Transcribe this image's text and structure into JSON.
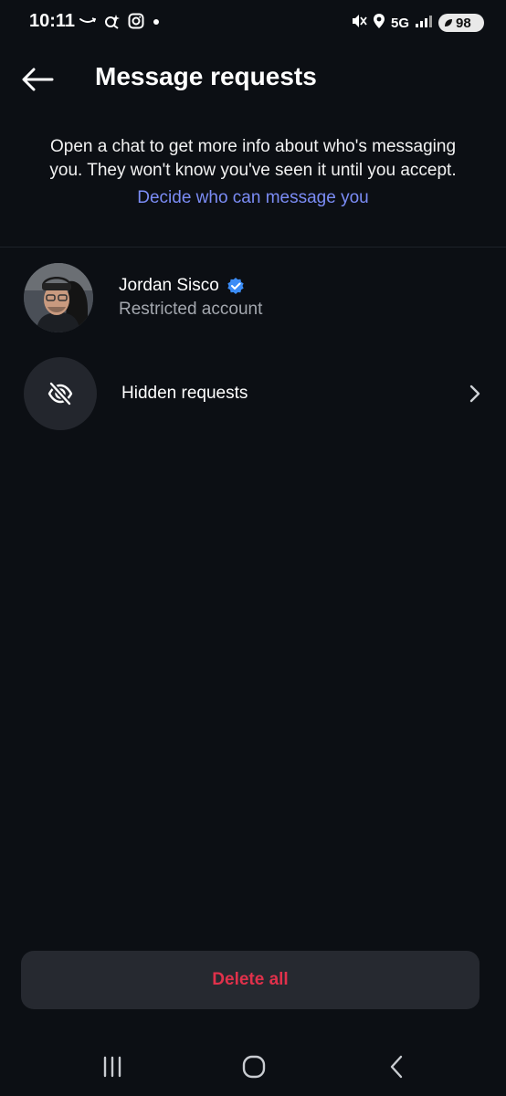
{
  "status_bar": {
    "time": "10:11",
    "network": "5G",
    "battery": "98",
    "left_icons": [
      "amazon-smile-icon",
      "assistant-icon",
      "instagram-icon",
      "dot-icon"
    ],
    "right_icons": [
      "mute-icon",
      "location-icon",
      "signal-icon",
      "battery-icon"
    ]
  },
  "header": {
    "title": "Message requests",
    "back_icon": "arrow-left-icon"
  },
  "info": {
    "text": "Open a chat to get more info about who's messaging you. They won't know you've seen it until you accept.",
    "link": "Decide who can message you"
  },
  "requests": [
    {
      "name": "Jordan Sisco",
      "verified": true,
      "subtitle": "Restricted account"
    }
  ],
  "hidden_requests": {
    "label": "Hidden requests",
    "icon": "eye-off-icon"
  },
  "footer": {
    "delete_label": "Delete all"
  },
  "nav": [
    "recent-apps-icon",
    "home-icon",
    "back-icon"
  ],
  "colors": {
    "background": "#0c0f14",
    "link": "#7b8cf5",
    "danger": "#e0314b",
    "verified": "#3b8cf6"
  }
}
